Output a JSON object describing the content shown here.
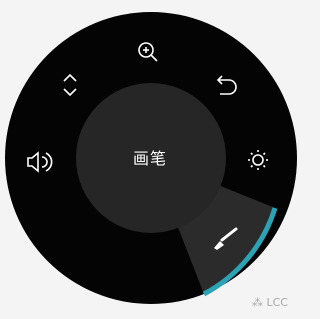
{
  "menu": {
    "center_label": "画笔",
    "items": [
      {
        "icon": "zoom-in-icon"
      },
      {
        "icon": "undo-icon"
      },
      {
        "icon": "brightness-icon"
      },
      {
        "icon": "brush-icon",
        "selected": true
      },
      {
        "icon": "volume-icon"
      },
      {
        "icon": "expand-icon"
      }
    ]
  },
  "colors": {
    "ring": "#040404",
    "center": "#262626",
    "selected_sector": "#2b2b2b",
    "accent": "#2aa3b5",
    "icon": "#ffffff",
    "background": "#f4f4f4"
  },
  "watermark": {
    "text": "LCC"
  }
}
